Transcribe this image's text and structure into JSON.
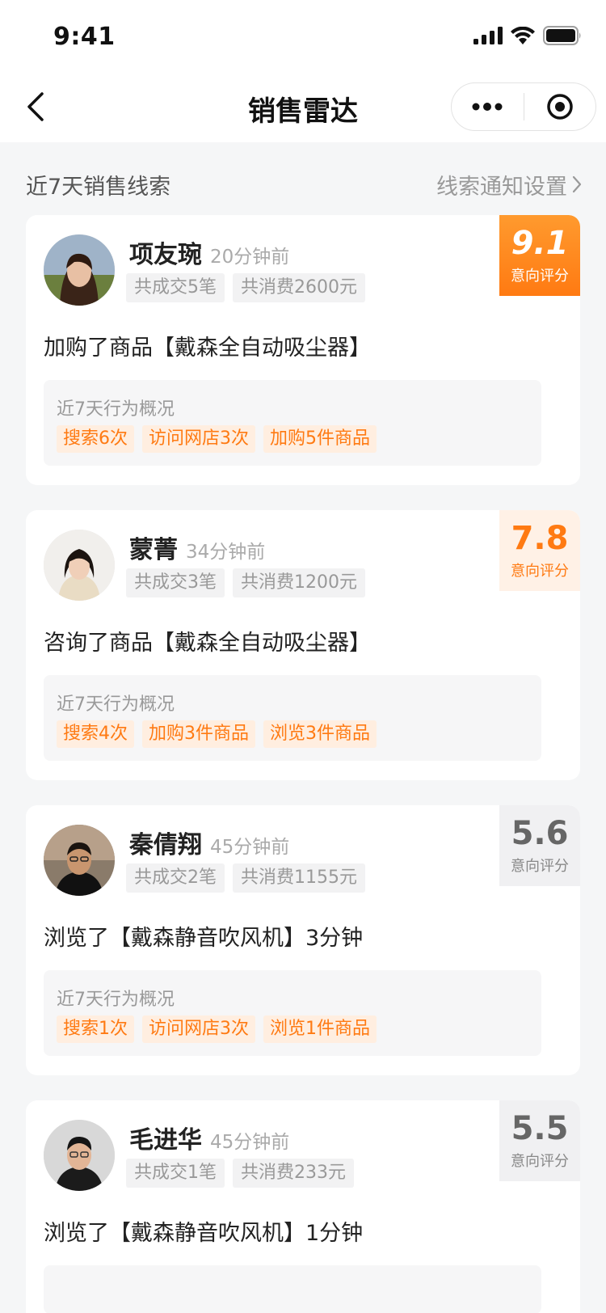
{
  "status_bar": {
    "time": "9:41"
  },
  "nav": {
    "title": "销售雷达"
  },
  "section": {
    "title": "近7天销售线索",
    "link": "线索通知设置"
  },
  "behavior_title": "近7天行为概况",
  "score_label": "意向评分",
  "leads": [
    {
      "name": "项友琬",
      "time": "20分钟前",
      "stats": [
        "共成交5笔",
        "共消费2600元"
      ],
      "score": "9.1",
      "score_level": "hot",
      "action": "加购了商品【戴森全自动吸尘器】",
      "tags": [
        "搜索6次",
        "访问网店3次",
        "加购5件商品"
      ]
    },
    {
      "name": "蒙菁",
      "time": "34分钟前",
      "stats": [
        "共成交3笔",
        "共消费1200元"
      ],
      "score": "7.8",
      "score_level": "warm",
      "action": "咨询了商品【戴森全自动吸尘器】",
      "tags": [
        "搜索4次",
        "加购3件商品",
        "浏览3件商品"
      ]
    },
    {
      "name": "秦倩翔",
      "time": "45分钟前",
      "stats": [
        "共成交2笔",
        "共消费1155元"
      ],
      "score": "5.6",
      "score_level": "cool",
      "action": "浏览了【戴森静音吹风机】3分钟",
      "tags": [
        "搜索1次",
        "访问网店3次",
        "浏览1件商品"
      ]
    },
    {
      "name": "毛进华",
      "time": "45分钟前",
      "stats": [
        "共成交1笔",
        "共消费233元"
      ],
      "score": "5.5",
      "score_level": "cool",
      "action": "浏览了【戴森静音吹风机】1分钟",
      "tags": []
    }
  ],
  "colors": {
    "accent": "#ff7a12",
    "tag_bg": "#ffeee0",
    "page_bg": "#f5f6f7"
  }
}
